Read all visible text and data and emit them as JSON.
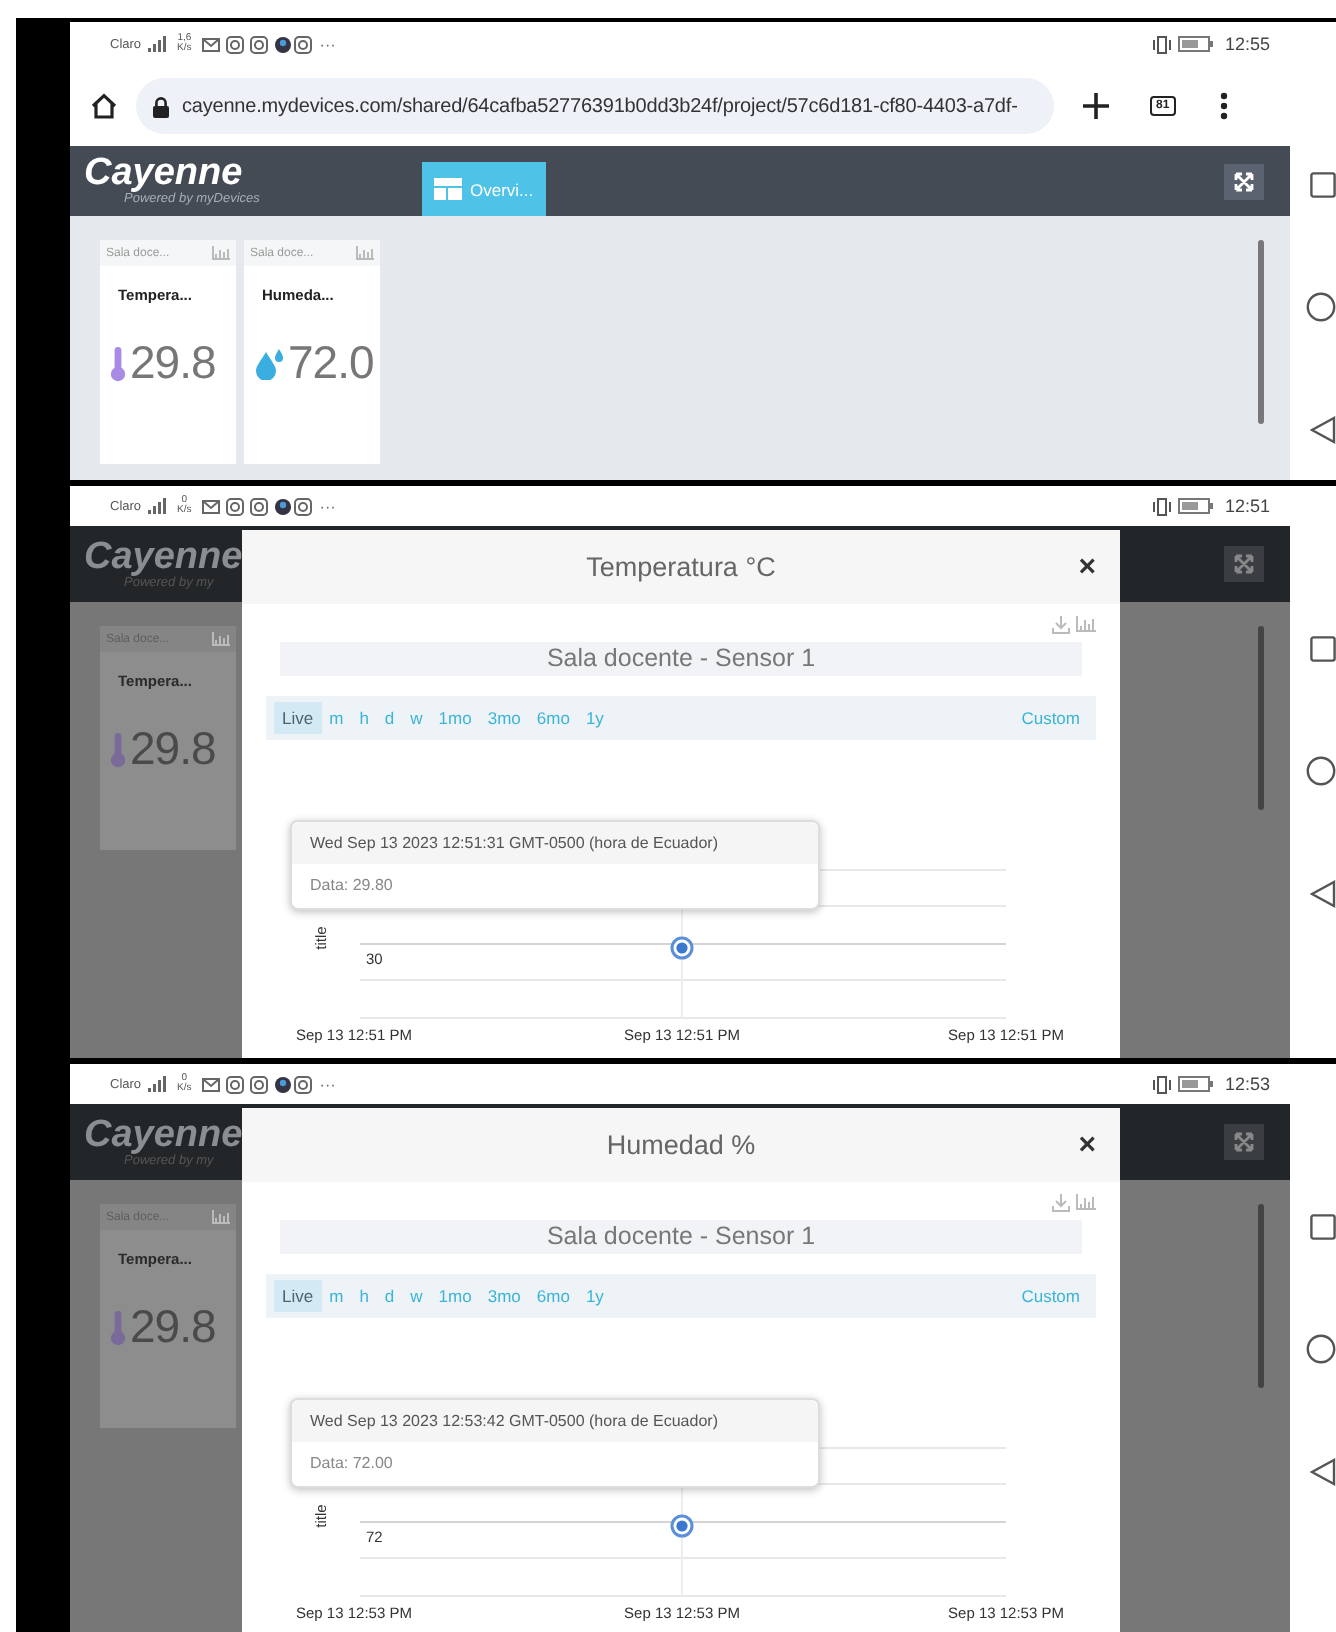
{
  "panels": [
    {
      "dimmed": false,
      "status_bar": {
        "carrier": "Claro",
        "speed": "1,6",
        "speed_unit": "K/s",
        "more": "···",
        "time": "12:55"
      },
      "browser": {
        "url": "cayenne.mydevices.com/shared/64cafba52776391b0dd3b24f/project/57c6d181-cf80-4403-a7df-",
        "tab_count": "81"
      },
      "app": {
        "logo": "Cayenne",
        "tagline": "Powered by myDevices",
        "tab": {
          "label": "Overvi...",
          "selected": true
        }
      },
      "widgets": [
        {
          "kind": "temperature",
          "source": "Sala doce...",
          "name": "Tempera...",
          "value": "29.8"
        },
        {
          "kind": "humidity",
          "source": "Sala doce...",
          "name": "Humeda...",
          "value": "72.0"
        }
      ]
    },
    {
      "dimmed": true,
      "status_bar": {
        "carrier": "Claro",
        "speed": "0",
        "speed_unit": "K/s",
        "more": "···",
        "time": "12:51"
      },
      "app": {
        "logo": "Cayenne",
        "tagline": "Powered by my"
      },
      "widgets": [
        {
          "kind": "temperature",
          "source": "Sala doce...",
          "name": "Tempera...",
          "value": "29.8"
        }
      ],
      "modal": {
        "title": "Temperatura °C",
        "close": "×",
        "subtitle": "Sala docente - Sensor 1",
        "ranges": [
          {
            "kind": "preset",
            "label": "Live",
            "selected": true
          },
          {
            "kind": "preset",
            "label": "m",
            "selected": false
          },
          {
            "kind": "preset",
            "label": "h",
            "selected": false
          },
          {
            "kind": "preset",
            "label": "d",
            "selected": false
          },
          {
            "kind": "preset",
            "label": "w",
            "selected": false
          },
          {
            "kind": "preset",
            "label": "1mo",
            "selected": false
          },
          {
            "kind": "preset",
            "label": "3mo",
            "selected": false
          },
          {
            "kind": "preset",
            "label": "6mo",
            "selected": false
          },
          {
            "kind": "preset",
            "label": "1y",
            "selected": false
          },
          {
            "kind": "custom",
            "label": "Custom",
            "selected": false
          }
        ],
        "tooltip": {
          "time": "Wed Sep 13 2023 12:51:31 GMT-0500 (hora de Ecuador)",
          "data": "Data: 29.80"
        },
        "chart": {
          "y_axis_title": "title",
          "y_tick": "30",
          "x_labels": [
            "Sep 13 12:51 PM",
            "Sep 13 12:51 PM",
            "Sep 13 12:51 PM"
          ]
        }
      }
    },
    {
      "dimmed": true,
      "status_bar": {
        "carrier": "Claro",
        "speed": "0",
        "speed_unit": "K/s",
        "more": "···",
        "time": "12:53"
      },
      "app": {
        "logo": "Cayenne",
        "tagline": "Powered by my"
      },
      "widgets": [
        {
          "kind": "temperature",
          "source": "Sala doce...",
          "name": "Tempera...",
          "value": "29.8"
        }
      ],
      "modal": {
        "title": "Humedad %",
        "close": "×",
        "subtitle": "Sala docente - Sensor 1",
        "ranges": [
          {
            "kind": "preset",
            "label": "Live",
            "selected": true
          },
          {
            "kind": "preset",
            "label": "m",
            "selected": false
          },
          {
            "kind": "preset",
            "label": "h",
            "selected": false
          },
          {
            "kind": "preset",
            "label": "d",
            "selected": false
          },
          {
            "kind": "preset",
            "label": "w",
            "selected": false
          },
          {
            "kind": "preset",
            "label": "1mo",
            "selected": false
          },
          {
            "kind": "preset",
            "label": "3mo",
            "selected": false
          },
          {
            "kind": "preset",
            "label": "6mo",
            "selected": false
          },
          {
            "kind": "preset",
            "label": "1y",
            "selected": false
          },
          {
            "kind": "custom",
            "label": "Custom",
            "selected": false
          }
        ],
        "tooltip": {
          "time": "Wed Sep 13 2023 12:53:42 GMT-0500 (hora de Ecuador)",
          "data": "Data: 72.00"
        },
        "chart": {
          "y_axis_title": "title",
          "y_tick": "72",
          "x_labels": [
            "Sep 13 12:53 PM",
            "Sep 13 12:53 PM",
            "Sep 13 12:53 PM"
          ]
        }
      }
    }
  ]
}
